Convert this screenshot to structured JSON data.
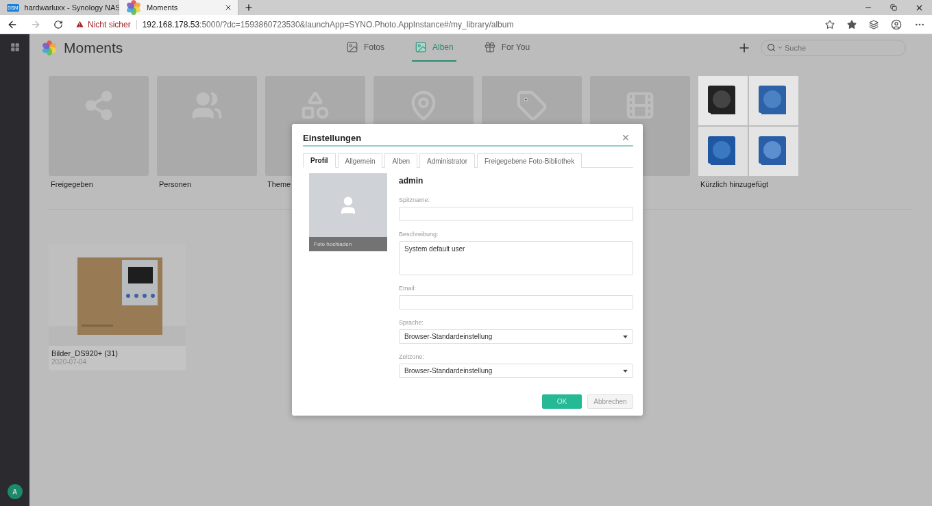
{
  "browser": {
    "tabs": [
      {
        "title": "hardwarluxx - Synology NAS",
        "badge": "DSM",
        "selected": false
      },
      {
        "title": "Moments",
        "selected": true
      }
    ],
    "security": "Nicht sicher",
    "host": "192.168.178.53",
    "path": ":5000/?dc=1593860723530&launchApp=SYNO.Photo.AppInstance#/my_library/album"
  },
  "sidebar": {
    "avatar": "A"
  },
  "app": {
    "title": "Moments",
    "nav": [
      {
        "label": "Fotos",
        "kind": "photos",
        "selected": false
      },
      {
        "label": "Alben",
        "kind": "albums",
        "selected": true
      },
      {
        "label": "For You",
        "kind": "gift",
        "selected": false
      }
    ],
    "search": {
      "placeholder": "Suche"
    }
  },
  "categories": [
    {
      "kind": "share",
      "label": "Freigegeben"
    },
    {
      "kind": "people",
      "label": "Personen"
    },
    {
      "kind": "themes",
      "label": "Theme"
    },
    {
      "kind": "place"
    },
    {
      "kind": "tag"
    },
    {
      "kind": "video"
    },
    {
      "kind": "recent",
      "label": "Kürzlich hinzugefügt"
    }
  ],
  "albums": [
    {
      "title": "Bilder_DS920+ (31)",
      "date": "2020-07-04",
      "kind": "picture"
    }
  ],
  "dialog": {
    "title": "Einstellungen",
    "tabs": [
      {
        "label": "Profil",
        "selected": true
      },
      {
        "label": "Allgemein",
        "selected": false
      },
      {
        "label": "Alben",
        "selected": false
      },
      {
        "label": "Administrator",
        "selected": false
      },
      {
        "label": "Freigegebene Foto-Bibliothek",
        "selected": false
      }
    ],
    "upload": "Foto hochladen",
    "username": "admin",
    "fields": [
      {
        "kind": "text",
        "label": "Spitzname:"
      },
      {
        "kind": "textarea",
        "label": "Beschreibung:",
        "value": "System default user"
      },
      {
        "kind": "text",
        "label": "Email:"
      },
      {
        "kind": "select",
        "label": "Sprache:",
        "value": "Browser-Standardeinstellung"
      },
      {
        "kind": "select",
        "label": "Zeitzone:",
        "value": "Browser-Standardeinstellung"
      }
    ],
    "buttons": [
      {
        "label": "OK",
        "kind": "primary"
      },
      {
        "label": "Abbrechen",
        "kind": "secondary"
      }
    ]
  }
}
